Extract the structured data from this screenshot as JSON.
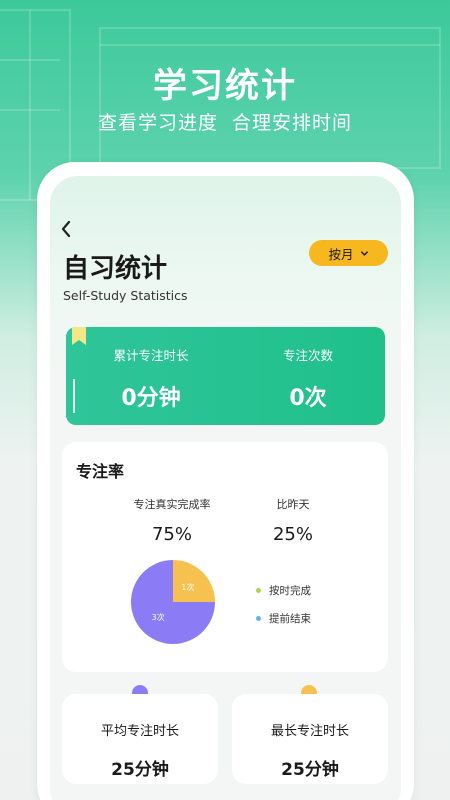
{
  "hero": {
    "title": "学习统计",
    "subtitle": "查看学习进度  合理安排时间"
  },
  "header": {
    "back_icon": "chevron-left-icon",
    "title": "自习统计",
    "subtitle": "Self-Study Statistics",
    "period_button": "按月",
    "period_chevron_icon": "chevron-down-icon"
  },
  "summary": {
    "total_label": "累计专注时长",
    "total_value": "0分钟",
    "count_label": "专注次数",
    "count_value": "0次"
  },
  "focus_rate": {
    "title": "专注率",
    "completion_label": "专注真实完成率",
    "completion_value": "75%",
    "vs_yesterday_label": "比昨天",
    "vs_yesterday_value": "25%"
  },
  "chart_data": {
    "type": "pie",
    "slices": [
      {
        "name": "按时完成",
        "label": "1次",
        "value": 1,
        "color": "#f6c14f"
      },
      {
        "name": "提前结束",
        "label": "3次",
        "value": 3,
        "color": "#8b7cf6"
      }
    ],
    "legend": [
      {
        "label": "按时完成",
        "color": "#a8d94a"
      },
      {
        "label": "提前结束",
        "color": "#5bb8f0"
      }
    ],
    "legend_position": "right"
  },
  "bottom_cards": {
    "avg_label": "平均专注时长",
    "avg_value": "25分钟",
    "avg_dot_color": "#8b7cf6",
    "max_label": "最长专注时长",
    "max_value": "25分钟",
    "max_dot_color": "#f6c14f"
  },
  "colors": {
    "accent_green": "#1fc08a",
    "accent_yellow": "#f6b71f"
  }
}
